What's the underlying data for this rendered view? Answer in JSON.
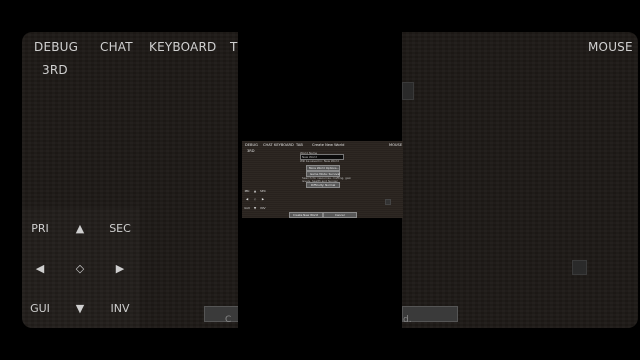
{
  "hud_background": {
    "top_labels": [
      "DEBUG",
      "CHAT",
      "KEYBOARD",
      "T"
    ],
    "third_label": "3RD",
    "mouse_label": "MOUSE",
    "dpad": {
      "pri": "PRI",
      "sec": "SEC",
      "gui": "GUI",
      "inv": "INV",
      "up": "▲",
      "down": "▼",
      "left": "◀",
      "right": "▶",
      "center": "◇"
    },
    "partial_buttons": [
      "C",
      "d."
    ]
  },
  "mini_screen": {
    "top_labels": [
      "DEBUG",
      "CHAT",
      "KEYBOARD",
      "TAB",
      "MOUSE"
    ],
    "third_label": "3RD",
    "dialog_title": "Create New World",
    "world_name_label": "World Name",
    "world_name_value": "New World",
    "save_note": "Will be saved in: New World",
    "more_world_options": "More World Options...",
    "game_mode_button": "Game Mode: Survival",
    "mode_desc_1": "Search for resources, crafting, gain",
    "mode_desc_2": "levels, health and hunger",
    "difficulty_button": "Difficulty: Normal",
    "create_button": "Create New World",
    "cancel_button": "Cancel",
    "dpad": {
      "pri": "PRI",
      "sec": "SEC",
      "gui": "GUI",
      "inv": "INV",
      "up": "▲",
      "down": "▼",
      "left": "◀",
      "right": "▶",
      "center": "◇"
    }
  },
  "colors": {
    "background": "#000000",
    "game_dirt": "#1e1a17",
    "button_gray": "#585858",
    "text_light": "#d8d8d8"
  }
}
